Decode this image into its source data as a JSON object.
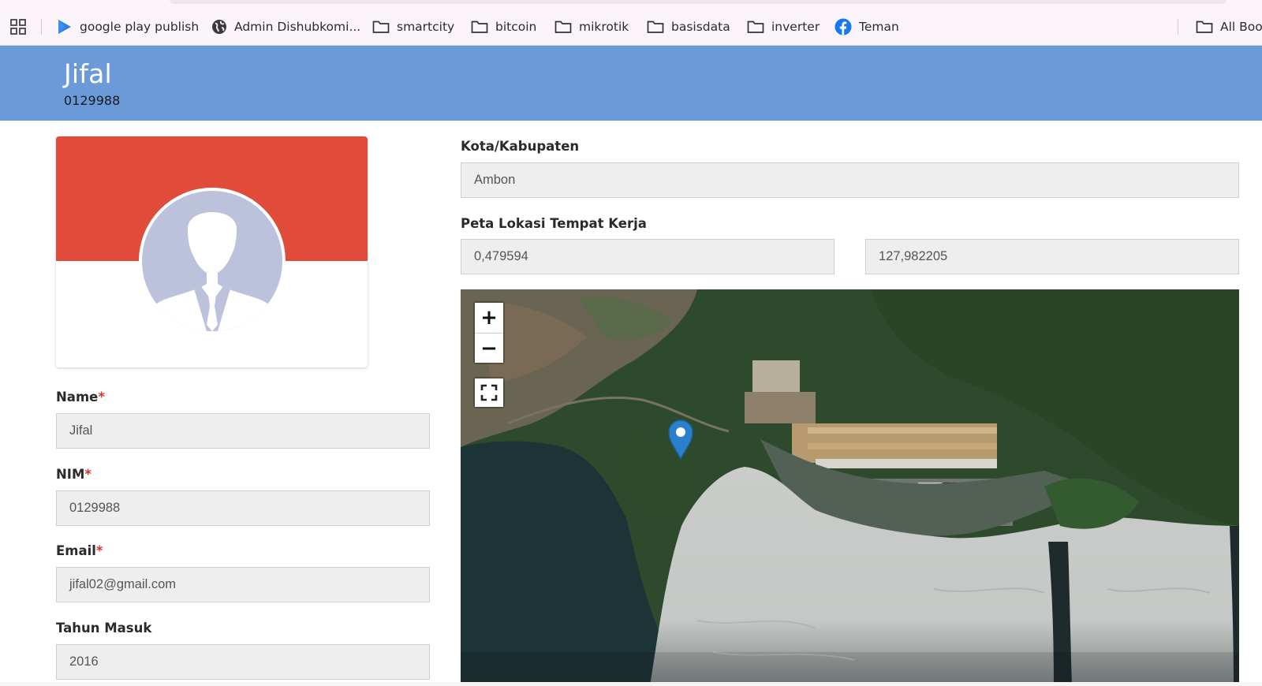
{
  "bookmarks": {
    "items": [
      {
        "label": "google play publish",
        "icon": "google-play-icon"
      },
      {
        "label": "Admin Dishubkomi...",
        "icon": "globe-icon"
      },
      {
        "label": "smartcity",
        "icon": "folder-icon"
      },
      {
        "label": "bitcoin",
        "icon": "folder-icon"
      },
      {
        "label": "mikrotik",
        "icon": "folder-icon"
      },
      {
        "label": "basisdata",
        "icon": "folder-icon"
      },
      {
        "label": "inverter",
        "icon": "folder-icon"
      },
      {
        "label": "Teman",
        "icon": "facebook-icon"
      }
    ],
    "all_bookmarks_label": "All Boo"
  },
  "header": {
    "name": "Jifal",
    "nim": "0129988",
    "background": "#6a9bd8"
  },
  "profile": {
    "banner_color": "#e04b3a",
    "avatar_icon": "user-silhouette-icon"
  },
  "form": {
    "name_label": "Name",
    "name_value": "Jifal",
    "nim_label": "NIM",
    "nim_value": "0129988",
    "email_label": "Email",
    "email_value": "jifal02@gmail.com",
    "tahun_label": "Tahun Masuk",
    "tahun_value": "2016",
    "required_mark": "*",
    "kota_label": "Kota/Kabupaten",
    "kota_value": "Ambon",
    "peta_label": "Peta Lokasi Tempat Kerja",
    "latitude_value": "0,479594",
    "longitude_value": "127,982205"
  },
  "map": {
    "zoom_in": "+",
    "zoom_out": "−",
    "fullscreen_icon": "fullscreen-icon",
    "marker_icon": "map-marker-icon",
    "marker_color": "#2a81cb"
  }
}
